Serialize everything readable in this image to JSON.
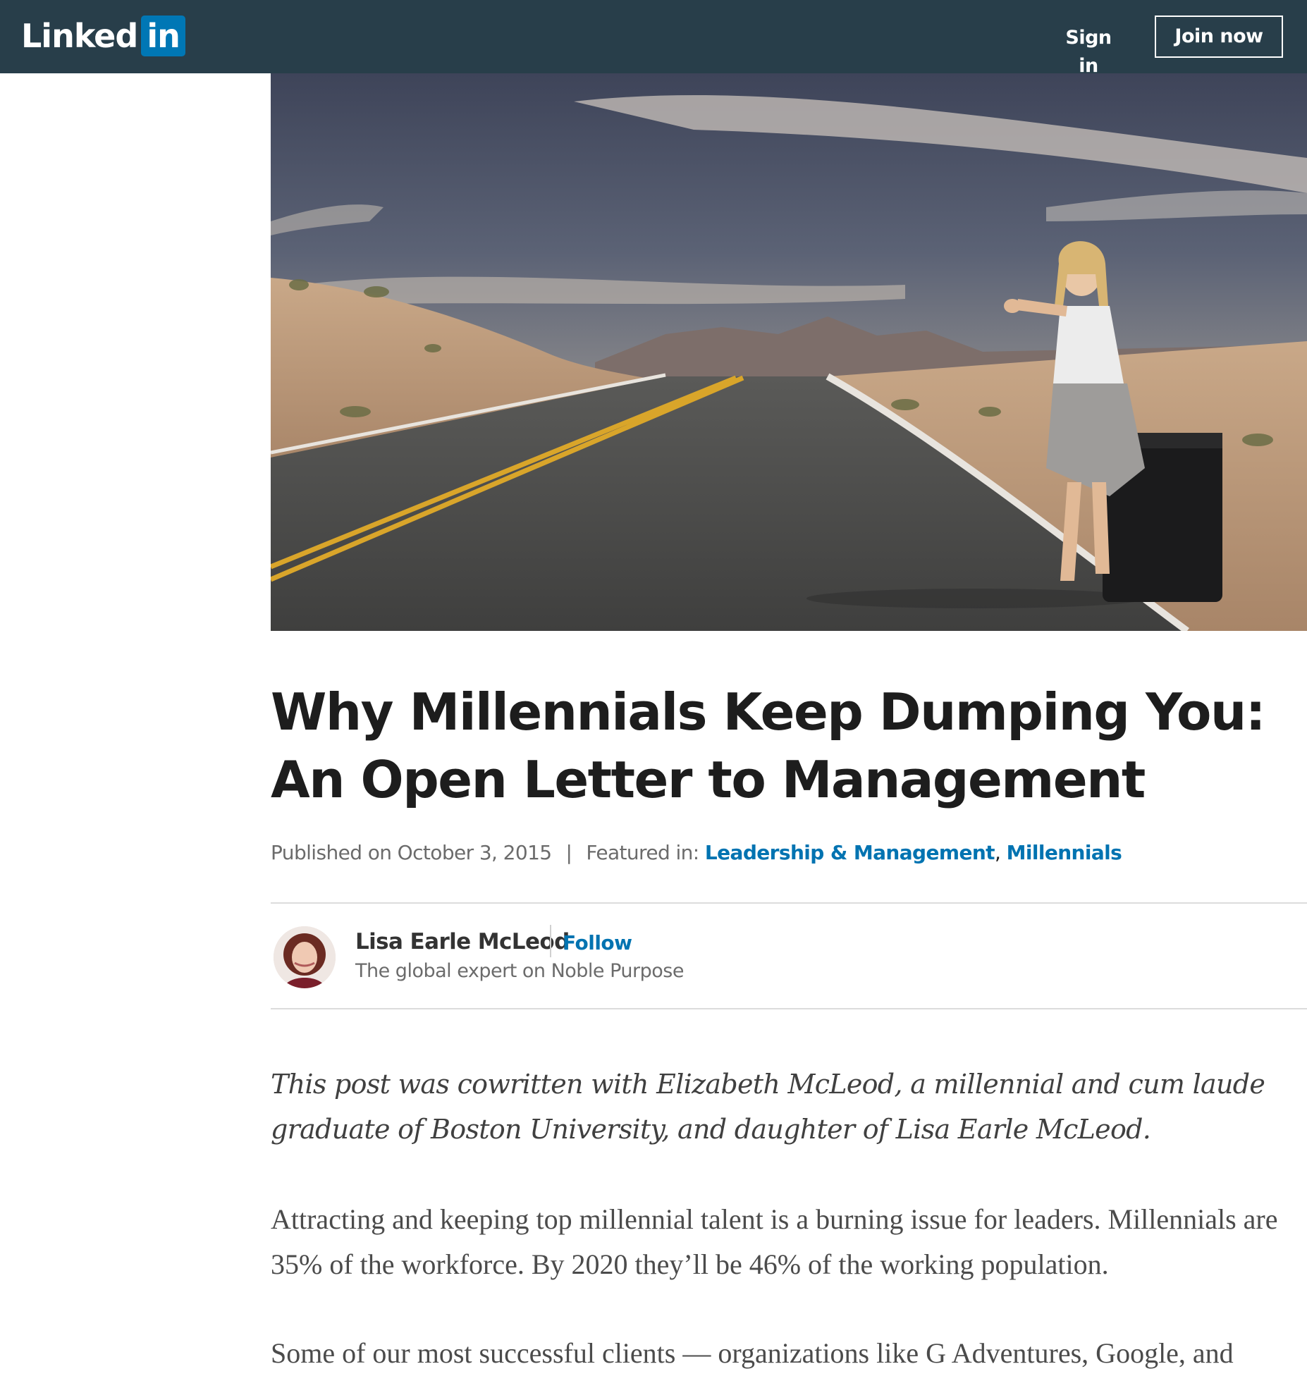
{
  "header": {
    "logo_word": "Linked",
    "logo_box": "in",
    "sign_in": "Sign in",
    "join_now": "Join now"
  },
  "hero": {
    "icon": "hero-photo"
  },
  "article": {
    "title": "Why Millennials Keep Dumping You: An Open Letter to Management",
    "published": "Published on October 3, 2015",
    "separator": "|",
    "featured_label": "Featured in:",
    "featured": [
      "Leadership & Management",
      "Millennials"
    ],
    "featured_comma": ","
  },
  "author": {
    "name": "Lisa Earle McLeod",
    "follow": "Follow",
    "headline": "The global expert on Noble Purpose"
  },
  "body": {
    "intro": "This post was cowritten with Elizabeth McLeod, a millennial and cum laude graduate of Boston University, and daughter of Lisa Earle McLeod.",
    "paragraph1": "Attracting and keeping top millennial talent is a burning issue for leaders. Millennials are 35% of the workforce. By 2020 they’ll be 46% of the working population.",
    "paragraph2": "Some of our most successful clients — organizations like G Adventures, Google, and"
  },
  "colors": {
    "nav_bg": "#283e4a",
    "brand_blue": "#0077b5",
    "link_blue": "#0073b1"
  }
}
